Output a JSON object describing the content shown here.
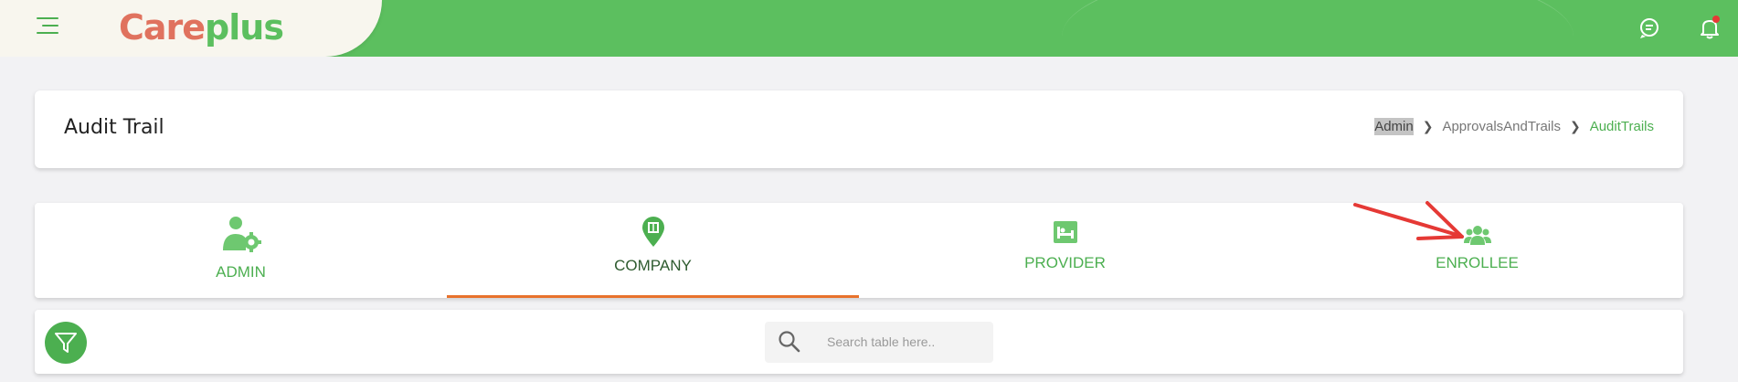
{
  "app": {
    "logo_left": "Care",
    "logo_right": "plus"
  },
  "header": {
    "title": "Audit Trail",
    "breadcrumb": [
      "Admin",
      "ApprovalsAndTrails",
      "AuditTrails"
    ]
  },
  "tabs": [
    {
      "label": "ADMIN",
      "icon": "user-gear-icon"
    },
    {
      "label": "COMPANY",
      "icon": "location-pin-icon",
      "active": true
    },
    {
      "label": "PROVIDER",
      "icon": "hospital-bed-icon"
    },
    {
      "label": "ENROLLEE",
      "icon": "users-icon"
    }
  ],
  "search": {
    "placeholder": "Search table here..",
    "value": ""
  },
  "colors": {
    "brand_green": "#5cbf5f",
    "logo_orange": "#e0725e",
    "active_tab_underline": "#e8722c",
    "annotation_arrow": "#e53935"
  }
}
